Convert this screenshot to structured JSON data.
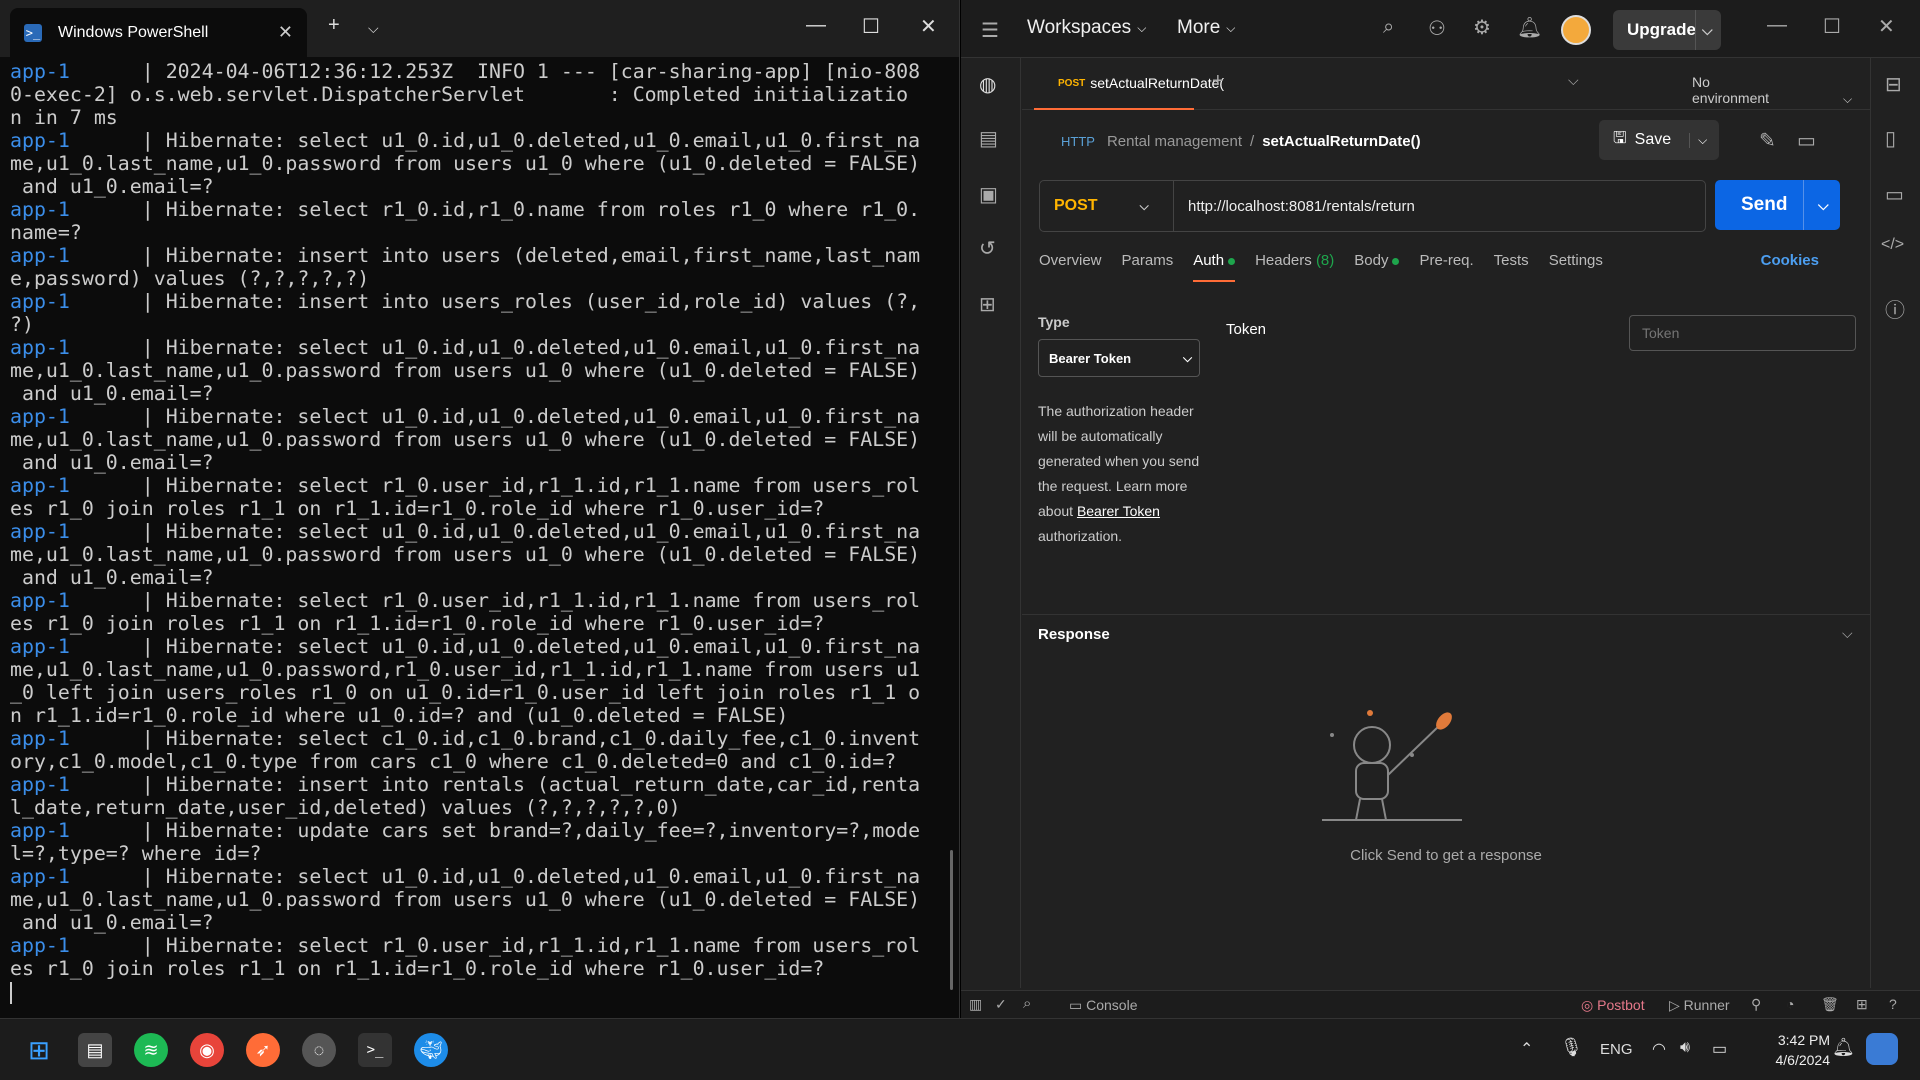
{
  "powershell": {
    "tab_title": "Windows PowerShell",
    "lines": [
      [
        "app-1",
        "      | 2024-04-06T12:36:12.253Z  INFO 1 --- [car-sharing-app] [nio-808"
      ],
      [
        "",
        "0-exec-2] o.s.web.servlet.DispatcherServlet       : Completed initializatio"
      ],
      [
        "",
        "n in 7 ms"
      ],
      [
        "app-1",
        "      | Hibernate: select u1_0.id,u1_0.deleted,u1_0.email,u1_0.first_na"
      ],
      [
        "",
        "me,u1_0.last_name,u1_0.password from users u1_0 where (u1_0.deleted = FALSE)"
      ],
      [
        "",
        " and u1_0.email=?"
      ],
      [
        "app-1",
        "      | Hibernate: select r1_0.id,r1_0.name from roles r1_0 where r1_0."
      ],
      [
        "",
        "name=?"
      ],
      [
        "app-1",
        "      | Hibernate: insert into users (deleted,email,first_name,last_nam"
      ],
      [
        "",
        "e,password) values (?,?,?,?,?)"
      ],
      [
        "app-1",
        "      | Hibernate: insert into users_roles (user_id,role_id) values (?,"
      ],
      [
        "",
        "?)"
      ],
      [
        "app-1",
        "      | Hibernate: select u1_0.id,u1_0.deleted,u1_0.email,u1_0.first_na"
      ],
      [
        "",
        "me,u1_0.last_name,u1_0.password from users u1_0 where (u1_0.deleted = FALSE)"
      ],
      [
        "",
        " and u1_0.email=?"
      ],
      [
        "app-1",
        "      | Hibernate: select u1_0.id,u1_0.deleted,u1_0.email,u1_0.first_na"
      ],
      [
        "",
        "me,u1_0.last_name,u1_0.password from users u1_0 where (u1_0.deleted = FALSE)"
      ],
      [
        "",
        " and u1_0.email=?"
      ],
      [
        "app-1",
        "      | Hibernate: select r1_0.user_id,r1_1.id,r1_1.name from users_rol"
      ],
      [
        "",
        "es r1_0 join roles r1_1 on r1_1.id=r1_0.role_id where r1_0.user_id=?"
      ],
      [
        "app-1",
        "      | Hibernate: select u1_0.id,u1_0.deleted,u1_0.email,u1_0.first_na"
      ],
      [
        "",
        "me,u1_0.last_name,u1_0.password from users u1_0 where (u1_0.deleted = FALSE)"
      ],
      [
        "",
        " and u1_0.email=?"
      ],
      [
        "app-1",
        "      | Hibernate: select r1_0.user_id,r1_1.id,r1_1.name from users_rol"
      ],
      [
        "",
        "es r1_0 join roles r1_1 on r1_1.id=r1_0.role_id where r1_0.user_id=?"
      ],
      [
        "app-1",
        "      | Hibernate: select u1_0.id,u1_0.deleted,u1_0.email,u1_0.first_na"
      ],
      [
        "",
        "me,u1_0.last_name,u1_0.password,r1_0.user_id,r1_1.id,r1_1.name from users u1"
      ],
      [
        "",
        "_0 left join users_roles r1_0 on u1_0.id=r1_0.user_id left join roles r1_1 o"
      ],
      [
        "",
        "n r1_1.id=r1_0.role_id where u1_0.id=? and (u1_0.deleted = FALSE)"
      ],
      [
        "app-1",
        "      | Hibernate: select c1_0.id,c1_0.brand,c1_0.daily_fee,c1_0.invent"
      ],
      [
        "",
        "ory,c1_0.model,c1_0.type from cars c1_0 where c1_0.deleted=0 and c1_0.id=?"
      ],
      [
        "app-1",
        "      | Hibernate: insert into rentals (actual_return_date,car_id,renta"
      ],
      [
        "",
        "l_date,return_date,user_id,deleted) values (?,?,?,?,?,0)"
      ],
      [
        "app-1",
        "      | Hibernate: update cars set brand=?,daily_fee=?,inventory=?,mode"
      ],
      [
        "",
        "l=?,type=? where id=?"
      ],
      [
        "app-1",
        "      | Hibernate: select u1_0.id,u1_0.deleted,u1_0.email,u1_0.first_na"
      ],
      [
        "",
        "me,u1_0.last_name,u1_0.password from users u1_0 where (u1_0.deleted = FALSE)"
      ],
      [
        "",
        " and u1_0.email=?"
      ],
      [
        "app-1",
        "      | Hibernate: select r1_0.user_id,r1_1.id,r1_1.name from users_rol"
      ],
      [
        "",
        "es r1_0 join roles r1_1 on r1_1.id=r1_0.role_id where r1_0.user_id=?"
      ]
    ]
  },
  "postman": {
    "menu": {
      "workspaces": "Workspaces",
      "more": "More",
      "upgrade": "Upgrade"
    },
    "tab": {
      "method": "POST",
      "name": "setActualReturnDate("
    },
    "environment": "No environment",
    "breadcrumb": {
      "collection": "Rental management",
      "sep": "/",
      "request": "setActualReturnDate()"
    },
    "save_label": "Save",
    "request": {
      "method": "POST",
      "url": "http://localhost:8081/rentals/return"
    },
    "send_label": "Send",
    "req_tabs": {
      "overview": "Overview",
      "params": "Params",
      "auth": "Auth",
      "headers": "Headers",
      "headers_count": "(8)",
      "body": "Body",
      "prereq": "Pre-req.",
      "tests": "Tests",
      "settings": "Settings",
      "cookies": "Cookies"
    },
    "auth": {
      "type_label": "Type",
      "type_value": "Bearer Token",
      "desc_prefix": "The authorization header will be automatically generated when you send the request. Learn more about ",
      "desc_link": "Bearer Token",
      "desc_suffix": " authorization.",
      "token_label": "Token",
      "token_placeholder": "Token"
    },
    "response": {
      "title": "Response",
      "empty_text": "Click Send to get a response"
    },
    "statusbar": {
      "console": "Console",
      "postbot": "Postbot",
      "runner": "Runner"
    }
  },
  "taskbar": {
    "lang": "ENG",
    "time": "3:42 PM",
    "date": "4/6/2024"
  },
  "colors": {
    "accent": "#ff6c37",
    "send": "#0c66e4",
    "post": "#ffb400",
    "prefix": "#3b8eea"
  }
}
